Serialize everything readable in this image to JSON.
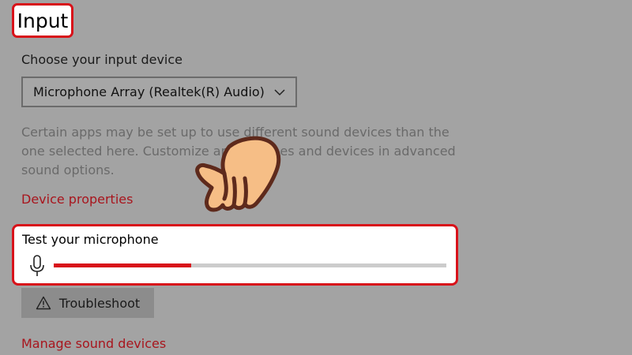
{
  "header": {
    "title": "Input"
  },
  "input_device": {
    "label": "Choose your input device",
    "selected": "Microphone Array (Realtek(R) Audio)",
    "chevron_icon": "chevron-down-icon"
  },
  "description": "Certain apps may be set up to use different sound devices than the one selected here. Customize app volumes and devices in advanced sound options.",
  "links": {
    "device_properties": "Device properties",
    "manage_sound_devices": "Manage sound devices"
  },
  "test": {
    "title": "Test your microphone",
    "icon": "microphone-icon",
    "level_fraction": 0.35
  },
  "troubleshoot": {
    "label": "Troubleshoot",
    "icon": "warning-icon"
  },
  "colors": {
    "highlight": "#d8121a",
    "link": "#a8151d",
    "background": "#a3a3a3",
    "meter_fill": "#d8121a",
    "meter_track": "#cccccc"
  },
  "overlay": {
    "icon": "pointing-hand-icon"
  }
}
